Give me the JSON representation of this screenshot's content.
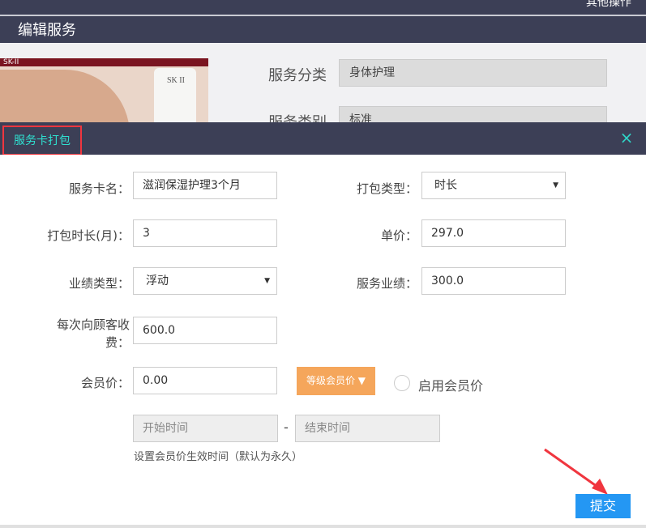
{
  "background": {
    "top_action": "其他操作",
    "page_title": "编辑服务",
    "promo_brand": "SK-II",
    "promo_tube_text": "SK II",
    "fields": [
      {
        "label": "服务分类",
        "value": "身体护理"
      },
      {
        "label": "服务类别",
        "value": "标准"
      }
    ]
  },
  "modal": {
    "title": "服务卡打包",
    "close_icon": "×",
    "form": {
      "card_name_label": "服务卡名：",
      "card_name_value": "滋润保湿护理3个月",
      "package_type_label": "打包类型：",
      "package_type_value": "时长",
      "duration_label": "打包时长(月)：",
      "duration_value": "3",
      "unit_price_label": "单价：",
      "unit_price_value": "297.0",
      "perf_type_label": "业绩类型：",
      "perf_type_value": "浮动",
      "service_perf_label": "服务业绩：",
      "service_perf_value": "300.0",
      "charge_label_line1": "每次向顾客收",
      "charge_label_line2": "费：",
      "charge_value": "600.0",
      "member_price_label": "会员价：",
      "member_price_value": "0.00",
      "level_button": "等级会员价",
      "enable_member_label": "启用会员价",
      "start_time_placeholder": "开始时间",
      "range_sep": "-",
      "end_time_placeholder": "结束时间",
      "hint": "设置会员价生效时间（默认为永久）"
    },
    "submit": "提交"
  },
  "colors": {
    "header": "#3c3f56",
    "accent_teal": "#2fe0d0",
    "highlight_red": "#f0363f",
    "submit_blue": "#2497f3",
    "level_orange": "#f5a65b"
  }
}
